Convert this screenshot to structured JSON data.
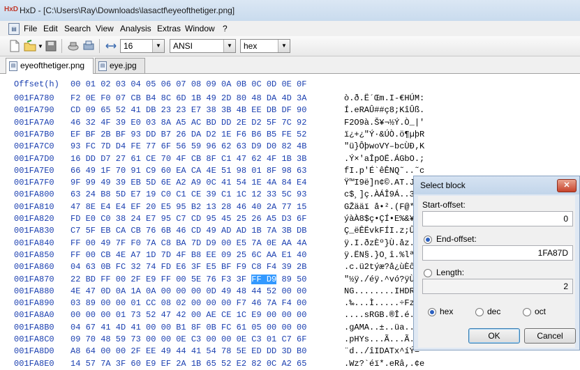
{
  "window": {
    "title": "HxD - [C:\\Users\\Ray\\Downloads\\lasactf\\eyeofthetiger.png]",
    "app_icon_text": "HxD"
  },
  "menu": {
    "items": [
      "File",
      "Edit",
      "Search",
      "View",
      "Analysis",
      "Extras",
      "Window",
      "?"
    ]
  },
  "toolbar": {
    "bytes_per_row": "16",
    "charset": "ANSI",
    "offset_base": "hex"
  },
  "tabs": [
    {
      "label": "eyeofthetiger.png"
    },
    {
      "label": "eye.jpg"
    }
  ],
  "hex_header": {
    "offset_label": "Offset(h)",
    "columns": "00 01 02 03 04 05 06 07 08 09 0A 0B 0C 0D 0E 0F"
  },
  "rows": [
    {
      "offset": "001FA780",
      "hex": "F2 0E F0 07 CB B4 8C 6D 1B 49 2D 80 48 DA 4D 3A",
      "ascii": "ò.ð.Ë´Œm.I-€HÚM:"
    },
    {
      "offset": "001FA790",
      "hex": "CD 09 65 52 41 DB 23 23 E7 38 3B 4B EE DB DF 90",
      "ascii": "Í.eRAÛ##ç8;KîÛß."
    },
    {
      "offset": "001FA7A0",
      "hex": "46 32 4F 39 E0 03 8A A5 AC BD DD 2E D2 5F 7C 92",
      "ascii": "F2O9à.Š¥¬½Ý.Ò_|'"
    },
    {
      "offset": "001FA7B0",
      "hex": "EF BF 2B BF 93 DD B7 26 DA D2 1E F6 B6 B5 FE 52",
      "ascii": "ï¿+¿\"Ý·&ÚÒ.ö¶µþR"
    },
    {
      "offset": "001FA7C0",
      "hex": "93 FC 7D D4 FE 77 6F 56 59 96 62 63 D9 D0 82 4B",
      "ascii": "\"ü}ÔþwoVY–bcÙÐ‚K"
    },
    {
      "offset": "001FA7D0",
      "hex": "16 DD D7 27 61 CE 70 4F CB 8F C1 47 62 4F 1B 3B",
      "ascii": ".Ý×'aÎpOË.ÁGbO.;"
    },
    {
      "offset": "001FA7E0",
      "hex": "66 49 1F 70 91 C9 60 EA CA 4E 51 98 01 8F 98 63",
      "ascii": "fI.p'É`êÊNQ˜..˜c"
    },
    {
      "offset": "001FA7F0",
      "hex": "9F 99 49 39 EB 5D 6E A2 A9 0C 41 54 1E 4A 84 E4",
      "ascii": "Ÿ™I9ë]n¢©.AT.J„ä"
    },
    {
      "offset": "001FA800",
      "hex": "63 24 B8 5D E7 19 C0 C1 CE 39 C1 1C 12 33 5C 93",
      "ascii": "c$¸]ç.ÀÁÎ9Á..3\\\""
    },
    {
      "offset": "001FA810",
      "hex": "47 8E E4 E4 EF 20 E5 95 B2 13 28 46 40 2A 77 15",
      "ascii": "GŽääï å•².(F@*w."
    },
    {
      "offset": "001FA820",
      "hex": "FD E0 C0 38 24 E7 95 C7 CD 95 45 25 26 A5 D3 6F",
      "ascii": "ýàÀ8$ç•ÇÍ•E%&¥Óo"
    },
    {
      "offset": "001FA830",
      "hex": "C7 5F EB CA CB 76 6B 46 CD 49 AD AD 1B 7A 3B DB",
      "ascii": "Ç_ëÊËvkFÍI­­.z;Û"
    },
    {
      "offset": "001FA840",
      "hex": "FF 00 49 7F F0 7A C8 BA 7D D9 00 E5 7A 0E AA 4A",
      "ascii": "ÿ.I.ðzÈº}Ù.åz.ªJ"
    },
    {
      "offset": "001FA850",
      "hex": "FF 00 CB 4E A7 1D 7D 4F B8 EE 09 25 6C AA E1 40",
      "ascii": "ÿ.ËN§.}O¸î.%lªá@"
    },
    {
      "offset": "001FA860",
      "hex": "04 63 0B FC 32 74 FD E6 3F E5 BF F9 C8 F4 39 2B",
      "ascii": ".c.ü2týæ?å¿ùÈô9+"
    },
    {
      "offset": "001FA870",
      "hex": "22 BD FF 00 2F E9 FF 00 5E 76 F3 3F FF D9 89 50",
      "ascii": "\"½ÿ./éÿ.^vó?ÿÙ‰P"
    },
    {
      "offset": "001FA880",
      "hex": "4E 47 0D 0A 1A 0A 00 00 00 0D 49 48 44 52 00 00",
      "ascii": "NG........IHDR.."
    },
    {
      "offset": "001FA890",
      "hex": "03 89 00 00 01 CC 08 02 00 00 00 F7 46 7A F4 00",
      "ascii": ".‰...Ì.....÷Fzô."
    },
    {
      "offset": "001FA8A0",
      "hex": "00 00 00 01 73 52 47 42 00 AE CE 1C E9 00 00 00",
      "ascii": "....sRGB.®Î.é..."
    },
    {
      "offset": "001FA8B0",
      "hex": "04 67 41 4D 41 00 00 B1 8F 0B FC 61 05 00 00 00",
      "ascii": ".gAMA..±..üa...."
    },
    {
      "offset": "001FA8C0",
      "hex": "09 70 48 59 73 00 00 0E C3 00 00 0E C3 01 C7 6F",
      "ascii": ".pHYs...Ã...Ã.Ço"
    },
    {
      "offset": "001FA8D0",
      "hex": "A8 64 00 00 2F EE 49 44 41 54 78 5E ED DD 3D B0",
      "ascii": "¨d../îIDATx^íÝ=°"
    },
    {
      "offset": "001FA8E0",
      "hex": "14 57 7A 3F 60 E9 EF 2A 1B 65 52 E2 82 0C A2 65",
      "ascii": ".Wz?`éï*.eRâ‚.¢e"
    }
  ],
  "selection": {
    "row": 15,
    "hex_text": "FF D9",
    "ascii_text": "ÿÙ"
  },
  "dialog": {
    "title": "Select block",
    "start_label": "Start-offset:",
    "start_value": "0",
    "end_label": "End-offset:",
    "end_value": "1FA87D",
    "length_label": "Length:",
    "length_value": "2",
    "base_hex": "hex",
    "base_dec": "dec",
    "base_oct": "oct",
    "ok_label": "OK",
    "cancel_label": "Cancel"
  }
}
